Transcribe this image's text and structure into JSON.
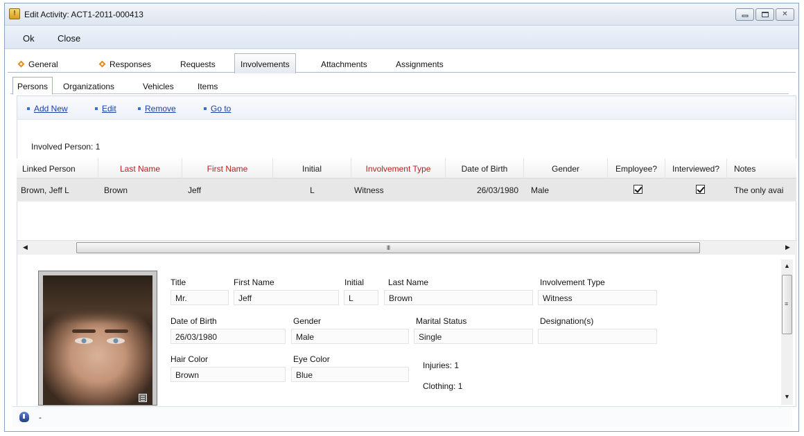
{
  "window": {
    "title": "Edit Activity: ACT1-2011-000413",
    "icon": "warning-app-icon",
    "app_icon_glyph": "!",
    "controls": [
      "minimize",
      "maximize",
      "close"
    ]
  },
  "menubar": {
    "ok_label": "Ok",
    "close_label": "Close"
  },
  "main_tabs": [
    {
      "label": "General",
      "marker": true
    },
    {
      "label": "Responses",
      "marker": true
    },
    {
      "label": "Requests",
      "marker": false
    },
    {
      "label": "Involvements",
      "marker": false,
      "active": true
    },
    {
      "label": "Attachments",
      "marker": false
    },
    {
      "label": "Assignments",
      "marker": false
    }
  ],
  "sub_tabs": [
    {
      "label": "Persons",
      "active": true
    },
    {
      "label": "Organizations"
    },
    {
      "label": "Vehicles"
    },
    {
      "label": "Items"
    }
  ],
  "actions": {
    "add_new": "Add New",
    "edit": "Edit",
    "remove": "Remove",
    "go_to": "Go to"
  },
  "involved_count_label": "Involved Person: 1",
  "grid": {
    "columns": [
      {
        "label": "Linked Person",
        "required": false
      },
      {
        "label": "Last Name",
        "required": true
      },
      {
        "label": "First Name",
        "required": true
      },
      {
        "label": "Initial",
        "required": false
      },
      {
        "label": "Involvement Type",
        "required": true
      },
      {
        "label": "Date of Birth",
        "required": false
      },
      {
        "label": "Gender",
        "required": false
      },
      {
        "label": "Employee?",
        "required": false
      },
      {
        "label": "Interviewed?",
        "required": false
      },
      {
        "label": "Notes",
        "required": false
      }
    ],
    "rows": [
      {
        "linked_person": "Brown, Jeff L",
        "last_name": "Brown",
        "first_name": "Jeff",
        "initial": "L",
        "involvement_type": "Witness",
        "date_of_birth": "26/03/1980",
        "gender": "Male",
        "employee": true,
        "interviewed": true,
        "notes": "The only avai"
      }
    ],
    "scrollbar_grip": "III"
  },
  "detail": {
    "title_label": "Title",
    "title_value": "Mr.",
    "first_name_label": "First Name",
    "first_name_value": "Jeff",
    "initial_label": "Initial",
    "initial_value": "L",
    "last_name_label": "Last Name",
    "last_name_value": "Brown",
    "involvement_type_label": "Involvement Type",
    "involvement_type_value": "Witness",
    "dob_label": "Date of Birth",
    "dob_value": "26/03/1980",
    "gender_label": "Gender",
    "gender_value": "Male",
    "marital_label": "Marital Status",
    "marital_value": "Single",
    "designation_label": "Designation(s)",
    "designation_value": "",
    "hair_label": "Hair Color",
    "hair_value": "Brown",
    "eye_label": "Eye Color",
    "eye_value": "Blue",
    "injuries_label": "Injuries: 1",
    "clothing_label": "Clothing: 1"
  },
  "status": {
    "text": "-",
    "icon": "shield-info-icon"
  },
  "colors": {
    "required_header": "#b22222",
    "link": "#1a3fa8",
    "tab_marker": "#e8891a"
  }
}
